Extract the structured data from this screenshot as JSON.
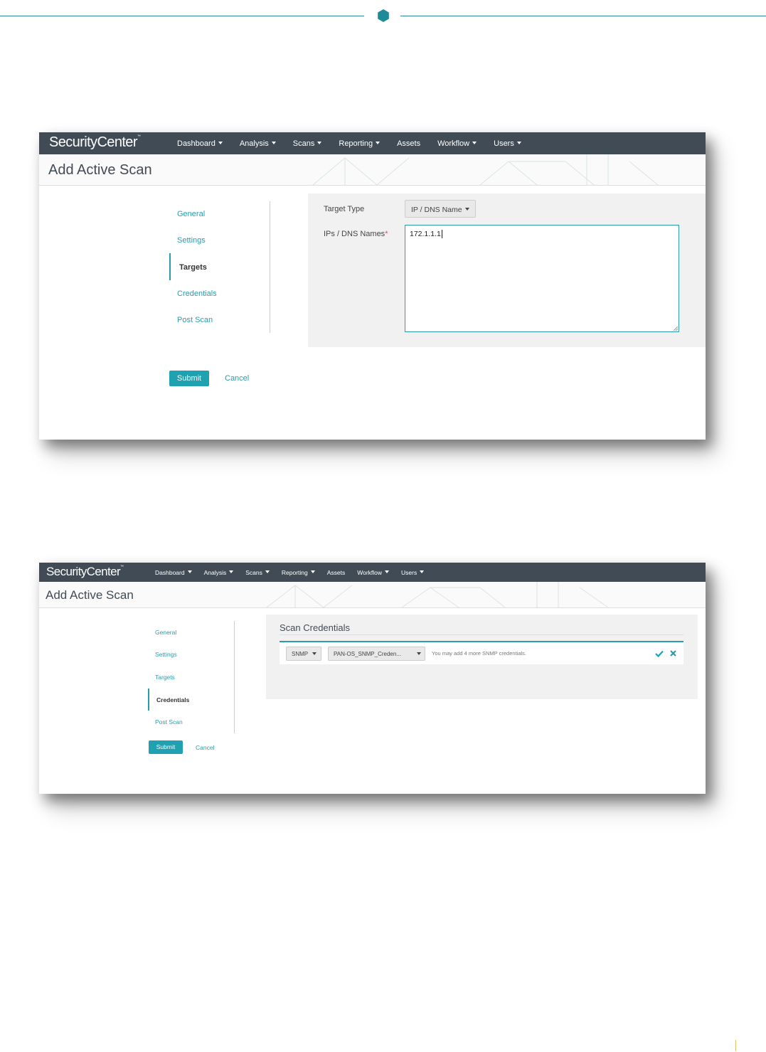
{
  "screens": [
    {
      "app_name": "SecurityCenter",
      "nav": {
        "items": [
          "Dashboard",
          "Analysis",
          "Scans",
          "Reporting",
          "Assets",
          "Workflow",
          "Users"
        ],
        "has_caret": [
          true,
          true,
          true,
          true,
          false,
          true,
          true
        ]
      },
      "page_title": "Add Active Scan",
      "sidebar": {
        "items": [
          "General",
          "Settings",
          "Targets",
          "Credentials",
          "Post Scan"
        ],
        "active": "Targets"
      },
      "form": {
        "target_type_label": "Target Type",
        "target_type_value": "IP / DNS Name",
        "ips_label": "IPs / DNS Names",
        "required_mark": "*",
        "ips_value": "172.1.1.1"
      },
      "submit_label": "Submit",
      "cancel_label": "Cancel"
    },
    {
      "app_name": "SecurityCenter",
      "nav": {
        "items": [
          "Dashboard",
          "Analysis",
          "Scans",
          "Reporting",
          "Assets",
          "Workflow",
          "Users"
        ],
        "has_caret": [
          true,
          true,
          true,
          true,
          false,
          true,
          true
        ]
      },
      "page_title": "Add Active Scan",
      "sidebar": {
        "items": [
          "General",
          "Settings",
          "Targets",
          "Credentials",
          "Post Scan"
        ],
        "active": "Credentials"
      },
      "credentials": {
        "section_title": "Scan Credentials",
        "type_value": "SNMP",
        "credential_value": "PAN-OS_SNMP_Creden...",
        "hint": "You may add 4 more SNMP credentials."
      },
      "submit_label": "Submit",
      "cancel_label": "Cancel"
    }
  ],
  "colors": {
    "accent": "#2b9cac",
    "nav_bg": "#404b55",
    "button_bg": "#1fa1b1"
  }
}
